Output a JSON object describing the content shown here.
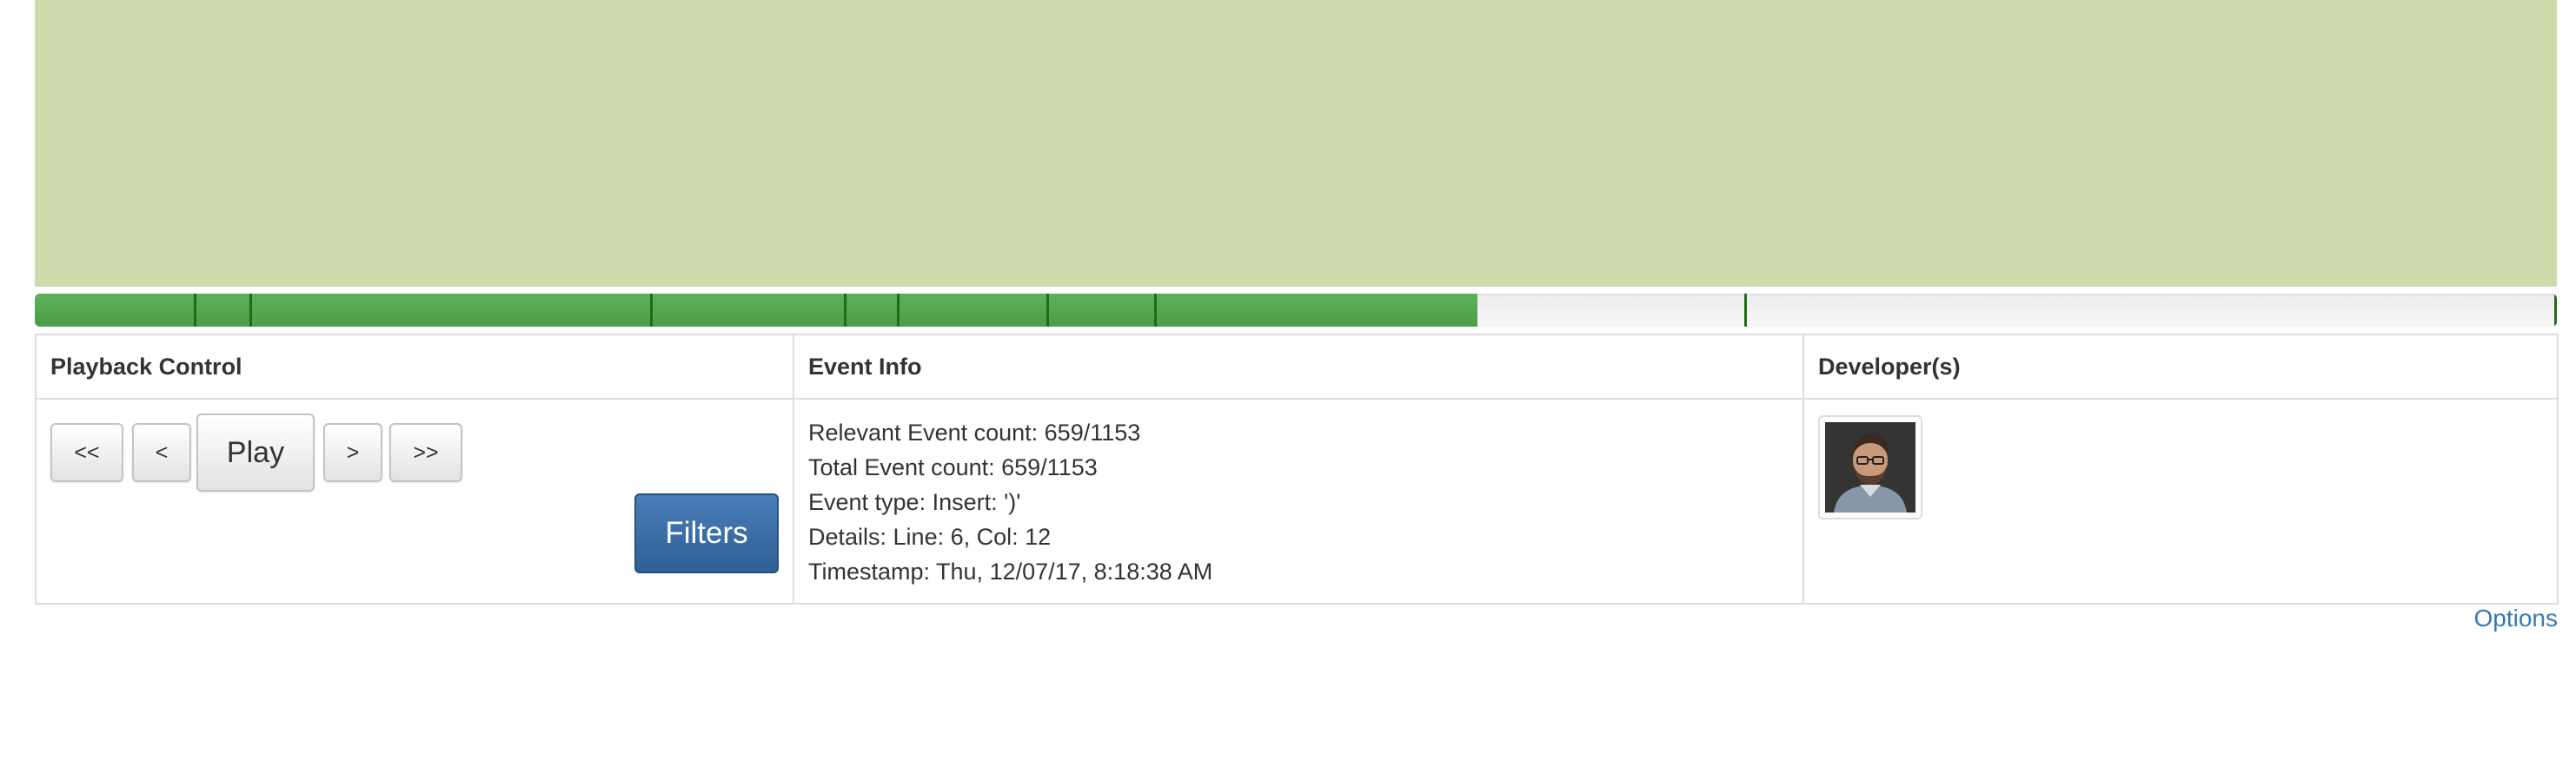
{
  "playback": {
    "progress_fraction": 0.572,
    "event_markers": [
      0.064,
      0.086,
      0.245,
      0.322,
      0.343,
      0.402,
      0.445,
      0.679,
      1.0
    ],
    "colors": {
      "fill": "#4a9e46",
      "marker": "#1f6b1c",
      "background": "#cddaab"
    }
  },
  "table": {
    "headers": {
      "playback": "Playback Control",
      "event_info": "Event Info",
      "developers": "Developer(s)"
    }
  },
  "controls": {
    "first_label": "<<",
    "prev_label": "<",
    "play_label": "Play",
    "next_label": ">",
    "last_label": ">>",
    "filters_label": "Filters"
  },
  "event_info": {
    "relevant": "Relevant Event count: 659/1153",
    "total": "Total Event count: 659/1153",
    "type": "Event type: Insert: ')'",
    "details": "Details: Line: 6, Col: 12",
    "timestamp": "Timestamp: Thu, 12/07/17, 8:18:38 AM"
  },
  "developers": {
    "avatar_icon": "developer-avatar"
  },
  "footer": {
    "options_label": "Options"
  }
}
